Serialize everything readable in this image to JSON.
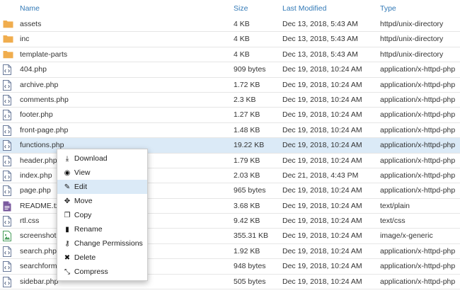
{
  "columns": {
    "name": "Name",
    "size": "Size",
    "modified": "Last Modified",
    "type": "Type"
  },
  "colors": {
    "folder": "#f0ad4e",
    "selected_row": "#dbeaf7",
    "header_link": "#337ab7"
  },
  "rows": [
    {
      "icon": "folder-icon",
      "name": "assets",
      "size": "4 KB",
      "modified": "Dec 13, 2018, 5:43 AM",
      "type": "httpd/unix-directory"
    },
    {
      "icon": "folder-icon",
      "name": "inc",
      "size": "4 KB",
      "modified": "Dec 13, 2018, 5:43 AM",
      "type": "httpd/unix-directory"
    },
    {
      "icon": "folder-icon",
      "name": "template-parts",
      "size": "4 KB",
      "modified": "Dec 13, 2018, 5:43 AM",
      "type": "httpd/unix-directory"
    },
    {
      "icon": "code-file-icon",
      "name": "404.php",
      "size": "909 bytes",
      "modified": "Dec 19, 2018, 10:24 AM",
      "type": "application/x-httpd-php"
    },
    {
      "icon": "code-file-icon",
      "name": "archive.php",
      "size": "1.72 KB",
      "modified": "Dec 19, 2018, 10:24 AM",
      "type": "application/x-httpd-php"
    },
    {
      "icon": "code-file-icon",
      "name": "comments.php",
      "size": "2.3 KB",
      "modified": "Dec 19, 2018, 10:24 AM",
      "type": "application/x-httpd-php"
    },
    {
      "icon": "code-file-icon",
      "name": "footer.php",
      "size": "1.27 KB",
      "modified": "Dec 19, 2018, 10:24 AM",
      "type": "application/x-httpd-php"
    },
    {
      "icon": "code-file-icon",
      "name": "front-page.php",
      "size": "1.48 KB",
      "modified": "Dec 19, 2018, 10:24 AM",
      "type": "application/x-httpd-php"
    },
    {
      "icon": "code-file-icon",
      "name": "functions.php",
      "size": "19.22 KB",
      "modified": "Dec 19, 2018, 10:24 AM",
      "type": "application/x-httpd-php",
      "selected": true
    },
    {
      "icon": "code-file-icon",
      "name": "header.php",
      "size": "1.79 KB",
      "modified": "Dec 19, 2018, 10:24 AM",
      "type": "application/x-httpd-php"
    },
    {
      "icon": "code-file-icon",
      "name": "index.php",
      "size": "2.03 KB",
      "modified": "Dec 21, 2018, 4:43 PM",
      "type": "application/x-httpd-php"
    },
    {
      "icon": "code-file-icon",
      "name": "page.php",
      "size": "965 bytes",
      "modified": "Dec 19, 2018, 10:24 AM",
      "type": "application/x-httpd-php"
    },
    {
      "icon": "text-file-icon",
      "name": "README.txt",
      "size": "3.68 KB",
      "modified": "Dec 19, 2018, 10:24 AM",
      "type": "text/plain"
    },
    {
      "icon": "code-file-icon",
      "name": "rtl.css",
      "size": "9.42 KB",
      "modified": "Dec 19, 2018, 10:24 AM",
      "type": "text/css"
    },
    {
      "icon": "image-file-icon",
      "name": "screenshot.png",
      "size": "355.31 KB",
      "modified": "Dec 19, 2018, 10:24 AM",
      "type": "image/x-generic"
    },
    {
      "icon": "code-file-icon",
      "name": "search.php",
      "size": "1.92 KB",
      "modified": "Dec 19, 2018, 10:24 AM",
      "type": "application/x-httpd-php"
    },
    {
      "icon": "code-file-icon",
      "name": "searchform.php",
      "size": "948 bytes",
      "modified": "Dec 19, 2018, 10:24 AM",
      "type": "application/x-httpd-php"
    },
    {
      "icon": "code-file-icon",
      "name": "sidebar.php",
      "size": "505 bytes",
      "modified": "Dec 19, 2018, 10:24 AM",
      "type": "application/x-httpd-php"
    }
  ],
  "context_menu": {
    "items": [
      {
        "id": "download",
        "label": "Download",
        "icon": "download-icon",
        "glyph": "⤓"
      },
      {
        "id": "view",
        "label": "View",
        "icon": "eye-icon",
        "glyph": "◉"
      },
      {
        "id": "edit",
        "label": "Edit",
        "icon": "pencil-icon",
        "glyph": "✎",
        "hover": true
      },
      {
        "id": "move",
        "label": "Move",
        "icon": "move-arrows-icon",
        "glyph": "✥"
      },
      {
        "id": "copy",
        "label": "Copy",
        "icon": "copy-icon",
        "glyph": "❐"
      },
      {
        "id": "rename",
        "label": "Rename",
        "icon": "file-icon",
        "glyph": "▮"
      },
      {
        "id": "change-permissions",
        "label": "Change Permissions",
        "icon": "key-icon",
        "glyph": "⚷"
      },
      {
        "id": "delete",
        "label": "Delete",
        "icon": "close-icon",
        "glyph": "✖"
      },
      {
        "id": "compress",
        "label": "Compress",
        "icon": "compress-icon",
        "glyph": "⤡"
      }
    ]
  }
}
